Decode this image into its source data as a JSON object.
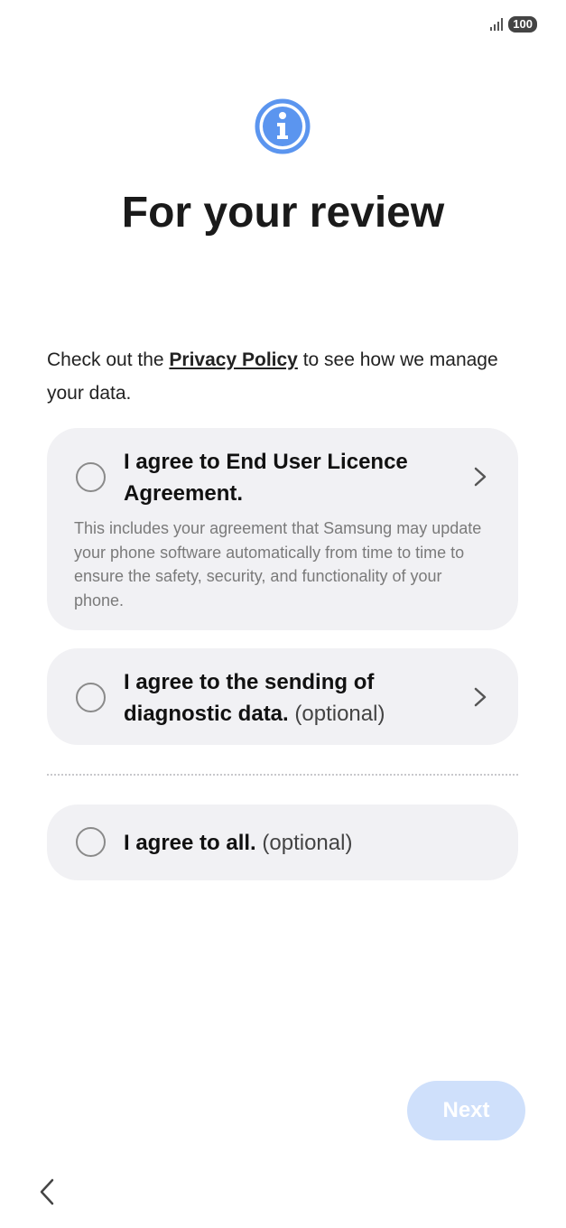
{
  "status_bar": {
    "battery_level": "100",
    "signal_icon": "signal-bars-icon"
  },
  "header": {
    "icon": "info-icon",
    "title": "For your review"
  },
  "intro": {
    "prefix": "Check out the ",
    "link_text": "Privacy Policy",
    "suffix": " to see how we manage your data."
  },
  "agreements": [
    {
      "label": "I agree to End User Licence Agreement.",
      "optional": "",
      "description": "This includes your agreement that Samsung may update your phone software automatically from time to time to ensure the safety, security, and functionality of your phone.",
      "checked": false
    },
    {
      "label": "I agree to the sending of diagnostic data.",
      "optional": "(optional)",
      "checked": false
    },
    {
      "label": "I agree to all.",
      "optional": "(optional)",
      "checked": false
    }
  ],
  "footer": {
    "next_label": "Next",
    "next_enabled": false
  },
  "colors": {
    "accent": "#5b95ef",
    "card_background": "#f1f1f4",
    "next_disabled": "#cfe0fb"
  }
}
